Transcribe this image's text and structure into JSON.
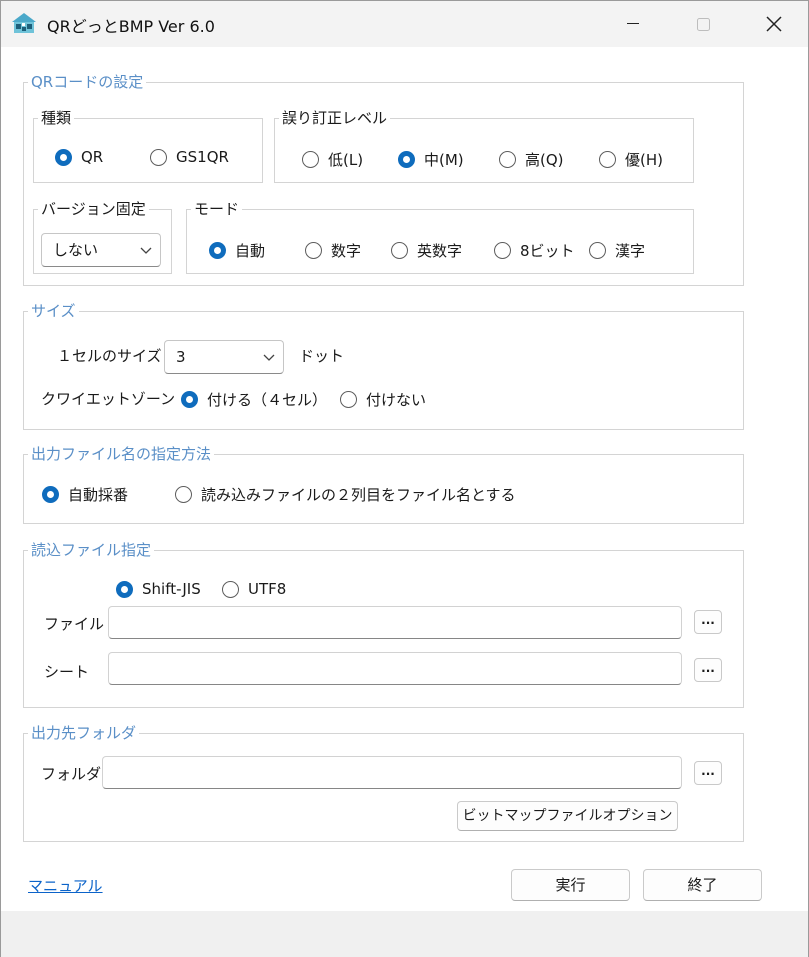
{
  "window": {
    "title": "QRどっとBMP Ver 6.0",
    "icon": "qr-house-icon",
    "controls": {
      "minimize": "minimize-icon",
      "maximize": "maximize-icon",
      "close": "close-icon"
    }
  },
  "qr_settings": {
    "legend": "QRコードの設定",
    "type": {
      "legend": "種類",
      "options": [
        {
          "label": "QR",
          "selected": true
        },
        {
          "label": "GS1QR",
          "selected": false
        }
      ]
    },
    "error_correction": {
      "legend": "誤り訂正レベル",
      "options": [
        {
          "label": "低(L)",
          "selected": false
        },
        {
          "label": "中(M)",
          "selected": true
        },
        {
          "label": "高(Q)",
          "selected": false
        },
        {
          "label": "優(H)",
          "selected": false
        }
      ]
    },
    "version": {
      "legend": "バージョン固定",
      "value": "しない"
    },
    "mode": {
      "legend": "モード",
      "options": [
        {
          "label": "自動",
          "selected": true
        },
        {
          "label": "数字",
          "selected": false
        },
        {
          "label": "英数字",
          "selected": false
        },
        {
          "label": "8ビット",
          "selected": false
        },
        {
          "label": "漢字",
          "selected": false
        }
      ]
    }
  },
  "size": {
    "legend": "サイズ",
    "cell_size_label": "１セルのサイズ",
    "cell_size_value": "3",
    "cell_size_unit": "ドット",
    "quiet_zone_label": "クワイエットゾーン",
    "quiet_zone_options": [
      {
        "label": "付ける（４セル）",
        "selected": true
      },
      {
        "label": "付けない",
        "selected": false
      }
    ]
  },
  "output_filename": {
    "legend": "出力ファイル名の指定方法",
    "options": [
      {
        "label": "自動採番",
        "selected": true
      },
      {
        "label": "読み込みファイルの２列目をファイル名とする",
        "selected": false
      }
    ]
  },
  "input_file": {
    "legend": "読込ファイル指定",
    "encoding_options": [
      {
        "label": "Shift-JIS",
        "selected": true
      },
      {
        "label": "UTF8",
        "selected": false
      }
    ],
    "file_label": "ファイル",
    "file_value": "",
    "sheet_label": "シート",
    "sheet_value": "",
    "browse_label": "..."
  },
  "output_folder": {
    "legend": "出力先フォルダ",
    "folder_label": "フォルダ",
    "folder_value": "",
    "browse_label": "...",
    "bitmap_option_label": "ビットマップファイルオプション"
  },
  "footer": {
    "manual_link": "マニュアル",
    "run_label": "実行",
    "exit_label": "終了"
  },
  "colors": {
    "accent": "#0f6cbd",
    "legend_blue": "#5a8fc7",
    "link": "#0b63c9"
  }
}
